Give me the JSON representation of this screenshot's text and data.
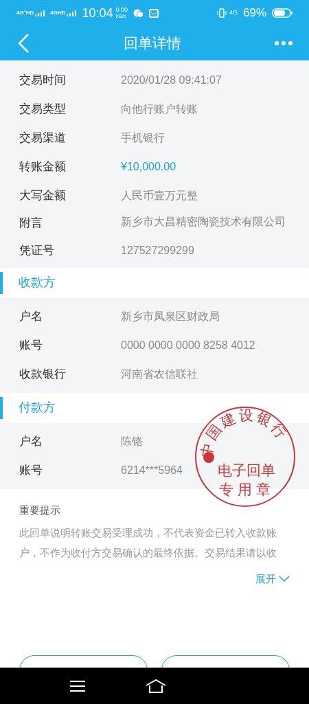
{
  "status_bar": {
    "network_1": "4G⁺HD",
    "network_2": "4GHD",
    "time": "10:04",
    "speed": "0.00",
    "speed_unit": "KB/s",
    "network_3": "4G",
    "battery": "69%"
  },
  "header": {
    "title": "回单详情"
  },
  "details": [
    {
      "label": "交易时间",
      "value": "2020/01/28  09:41:07",
      "kind": "plain"
    },
    {
      "label": "交易类型",
      "value": "向他行账户转账",
      "kind": "plain"
    },
    {
      "label": "交易渠道",
      "value": "手机银行",
      "kind": "plain"
    },
    {
      "label": "转账金额",
      "value": "¥10,000.00",
      "kind": "amount"
    },
    {
      "label": "大写金额",
      "value": "人民币壹万元整",
      "kind": "plain"
    },
    {
      "label": "附言",
      "value": "新乡市大昌精密陶瓷技术有限公司",
      "kind": "plain"
    },
    {
      "label": "凭证号",
      "value": "127527299299",
      "kind": "plain"
    }
  ],
  "sections": [
    {
      "title": "收款方",
      "rows": [
        {
          "label": "户名",
          "value": "新乡市凤泉区财政局"
        },
        {
          "label": "账号",
          "value": "0000 0000 0000 8258 4012"
        },
        {
          "label": "收款银行",
          "value": "河南省农信联社"
        }
      ]
    },
    {
      "title": "付款方",
      "rows": [
        {
          "label": "户名",
          "value": "陈铬"
        },
        {
          "label": "账号",
          "value": "6214***5964"
        }
      ]
    }
  ],
  "seal": {
    "bank": "中国建设银行",
    "line_1": "电子回单",
    "line_2": "专用章"
  },
  "notice": {
    "title": "重要提示",
    "text": "此回单说明转账交易受理成功，不代表资金已转入收款账户，不作为收付方交易确认的最终依据。交易结果请以收",
    "expand": "展开"
  }
}
